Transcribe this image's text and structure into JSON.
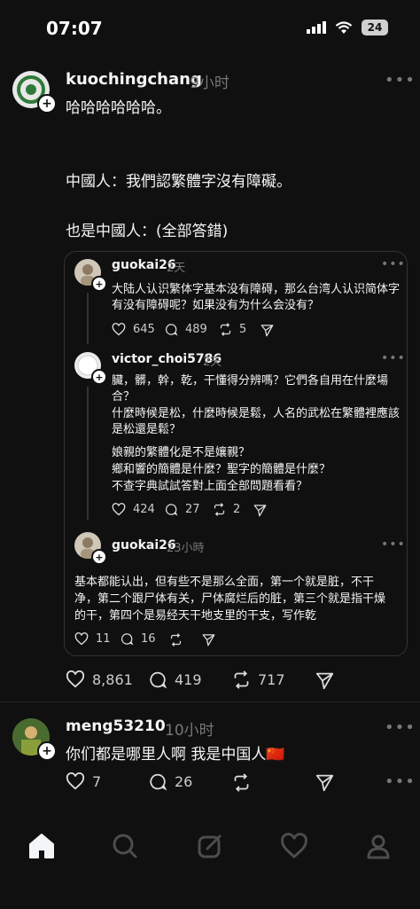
{
  "status_bar": {
    "time": "07:07",
    "battery": "24"
  },
  "post1": {
    "username": "kuochingchang",
    "time": "9小时",
    "lines": [
      "哈哈哈哈哈哈。",
      "中國人：我們認繁體字沒有障礙。",
      "也是中國人：(全部答錯)"
    ],
    "likes": "8,861",
    "comments": "419",
    "reposts": "717"
  },
  "quote": {
    "q1": {
      "username": "guokai26",
      "time": "2天",
      "lines": [
        "大陆人认识繁体字基本没有障碍，那么台湾人认识简体字",
        "有没有障碍呢？如果没有为什么会没有？"
      ],
      "likes": "645",
      "comments": "489",
      "reposts": "5"
    },
    "q2": {
      "username": "victor_choi5786",
      "time": "2天",
      "lines": [
        "臟，髒，幹，乾，干懂得分辨嗎？它們各自用在什麼場",
        "合？",
        "什麼時候是松，什麼時候是鬆，人名的武松在繁體裡應該",
        "是松還是鬆？",
        "娘親的繁體化是不是孃親？",
        "鄉和響的簡體是什麼？聖字的簡體是什麼？",
        "不查字典試試答對上面全部問題看看？"
      ],
      "likes": "424",
      "comments": "27",
      "reposts": "2"
    },
    "q3": {
      "username": "guokai26",
      "time": "23小時",
      "lines": [
        "基本都能认出，但有些不是那么全面，第一个就是脏，不干",
        "净，第二个跟尸体有关，尸体腐烂后的脏，第三个就是指干燥",
        "的干，第四个是易经天干地支里的干支，写作乾"
      ],
      "likes": "11",
      "comments": "16"
    }
  },
  "post2": {
    "username": "meng53210",
    "time": "10小时",
    "text": "你们都是哪里人啊 我是中国人🇨🇳",
    "likes": "7",
    "comments": "26"
  },
  "icons": {
    "heart": "heart-icon",
    "comment": "comment-icon",
    "repost": "repost-icon",
    "share": "share-icon",
    "home": "home-icon",
    "search": "search-icon",
    "compose": "compose-icon",
    "activity": "heart-icon",
    "profile": "profile-icon"
  },
  "colors": {
    "background": "#101010",
    "text": "#f3f5f7",
    "muted": "#777777",
    "border": "#333333"
  }
}
